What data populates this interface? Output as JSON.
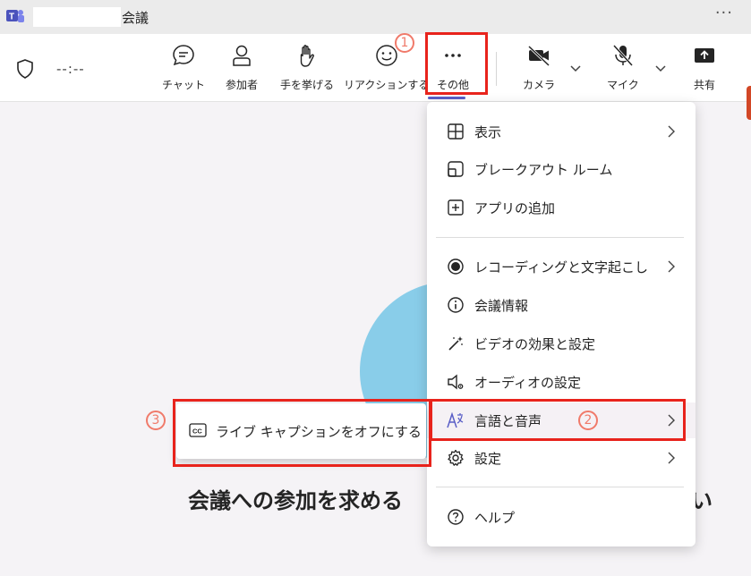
{
  "titlebar": {
    "title": "会議",
    "more": "···"
  },
  "toolbar": {
    "timer": "--:--",
    "chat_label": "チャット",
    "people_label": "参加者",
    "raise_hand_label": "手を挙げる",
    "reactions_label": "リアクションする",
    "more_label": "その他",
    "camera_label": "カメラ",
    "mic_label": "マイク",
    "share_label": "共有"
  },
  "main": {
    "prompt_text": "会議への参加を求める",
    "prompt_tail": "い"
  },
  "more_menu": {
    "items": [
      {
        "label": "表示"
      },
      {
        "label": "ブレークアウト ルーム"
      },
      {
        "label": "アプリの追加"
      },
      {
        "label": "レコーディングと文字起こし"
      },
      {
        "label": "会議情報"
      },
      {
        "label": "ビデオの効果と設定"
      },
      {
        "label": "オーディオの設定"
      },
      {
        "label": "言語と音声"
      },
      {
        "label": "設定"
      },
      {
        "label": "ヘルプ"
      }
    ]
  },
  "submenu": {
    "item_label": "ライブ キャプションをオフにする"
  },
  "annotations": {
    "step1": "1",
    "step2": "2",
    "step3": "3"
  },
  "colors": {
    "accent": "#5b5fc7",
    "highlight_box": "#e8231c",
    "step_badge": "#f07a6a",
    "avatar": "#89cde9"
  }
}
